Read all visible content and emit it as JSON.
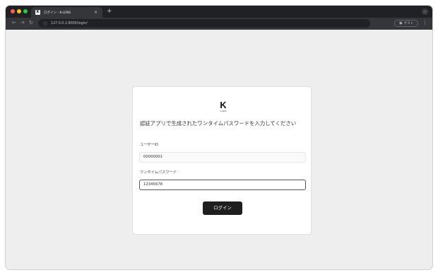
{
  "browser": {
    "tab_title": "ログイン - K-LENS",
    "tab_favicon_letter": "K",
    "tab_close": "×",
    "new_tab": "+",
    "url": "127.0.0.1:8000/login/",
    "profile_label": "ゲスト",
    "nav_back": "←",
    "nav_forward": "→",
    "nav_reload": "↻",
    "menu": "⋮",
    "site_info": "ⓘ",
    "tab_search": "⌄"
  },
  "login": {
    "logo_letter": "K",
    "logo_caption": "K-LENS",
    "instruction": "認証アプリで生成されたワンタイムパスワードを入力してください",
    "user_id_label": "ユーザーID",
    "user_id_value": "00000001",
    "otp_label": "ワンタイムパスワード",
    "otp_value": "12345678",
    "submit_label": "ログイン"
  },
  "colors": {
    "titlebar": "#202124",
    "toolbar": "#35363a",
    "page_background": "#eeeeef",
    "card": "#ffffff",
    "button": "#1f1f1f"
  }
}
